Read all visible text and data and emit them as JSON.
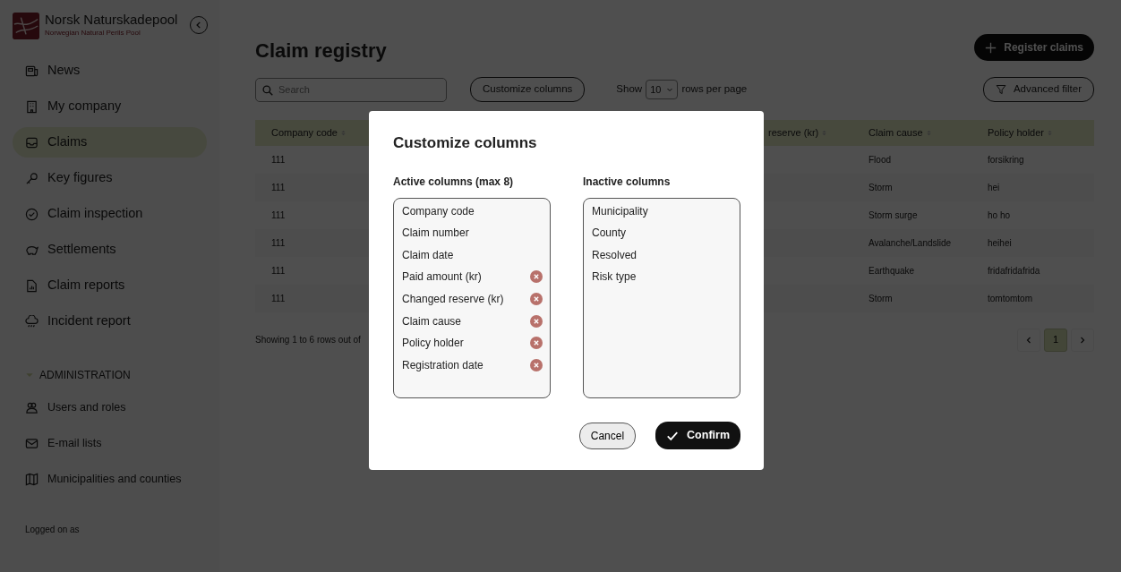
{
  "brand": {
    "name": "Norsk Naturskadepool",
    "subtitle": "Norwegian Natural Perils Pool"
  },
  "sidebar": {
    "items": [
      {
        "label": "News",
        "kind": "news",
        "selected": false
      },
      {
        "label": "My company",
        "kind": "building",
        "selected": false
      },
      {
        "label": "Claims",
        "kind": "inbox",
        "selected": true
      },
      {
        "label": "Key figures",
        "kind": "key",
        "selected": false
      },
      {
        "label": "Claim inspection",
        "kind": "check",
        "selected": false
      },
      {
        "label": "Settlements",
        "kind": "piggy",
        "selected": false
      },
      {
        "label": "Claim reports",
        "kind": "report",
        "selected": false
      },
      {
        "label": "Incident report",
        "kind": "cloud",
        "selected": false
      }
    ],
    "admin": {
      "label": "ADMINISTRATION",
      "expanded": true,
      "items": [
        {
          "label": "Users and roles",
          "kind": "users",
          "selected": false
        },
        {
          "label": "E-mail lists",
          "kind": "mail",
          "selected": false
        },
        {
          "label": "Municipalities and counties",
          "kind": "map",
          "selected": false
        }
      ]
    },
    "logged_on_label": "Logged on as"
  },
  "page": {
    "title": "Claim registry",
    "register_button": "Register claims",
    "search": {
      "placeholder": "Search"
    },
    "customize_button": "Customize columns",
    "show_label": "Show",
    "page_size": "10",
    "rows_per_page_label": "rows per page",
    "filter_button": "Advanced filter"
  },
  "table": {
    "columns": [
      "Company code",
      "reserve (kr)",
      "Claim cause",
      "Policy holder"
    ],
    "rows": [
      [
        "111",
        "",
        "Flood",
        "forsikring"
      ],
      [
        "111",
        "",
        "Storm",
        "hei"
      ],
      [
        "111",
        "",
        "Storm surge",
        "ho ho"
      ],
      [
        "111",
        "",
        "Avalanche/Landslide",
        "heihei"
      ],
      [
        "111",
        "",
        "Earthquake",
        "fridafridafrida"
      ],
      [
        "111",
        "",
        "Storm",
        "tomtomtom"
      ]
    ],
    "footer": "Showing 1 to 6 rows out of",
    "pages": [
      {
        "label": "1",
        "selected": true
      }
    ]
  },
  "modal": {
    "title": "Customize columns",
    "active": {
      "heading": "Active columns (max 8)",
      "items": [
        {
          "label": "Company code",
          "removable": false
        },
        {
          "label": "Claim number",
          "removable": false
        },
        {
          "label": "Claim date",
          "removable": false
        },
        {
          "label": "Paid amount (kr)",
          "removable": true
        },
        {
          "label": "Changed reserve (kr)",
          "removable": true
        },
        {
          "label": "Claim cause",
          "removable": true
        },
        {
          "label": "Policy holder",
          "removable": true
        },
        {
          "label": "Registration date",
          "removable": true
        }
      ]
    },
    "inactive": {
      "heading": "Inactive columns",
      "items": [
        "Municipality",
        "County",
        "Resolved",
        "Risk type"
      ]
    },
    "cancel": "Cancel",
    "confirm": "Confirm"
  }
}
